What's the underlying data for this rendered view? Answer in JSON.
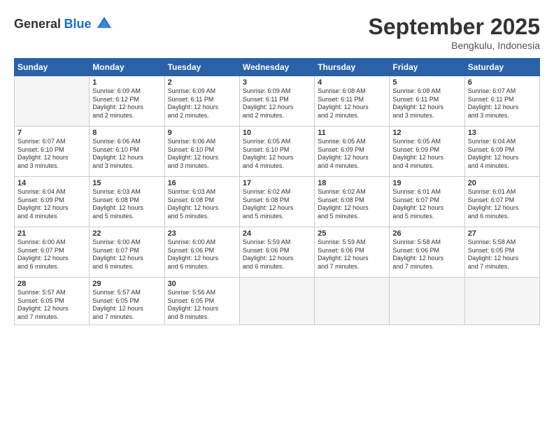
{
  "logo": {
    "general": "General",
    "blue": "Blue"
  },
  "header": {
    "title": "September 2025",
    "subtitle": "Bengkulu, Indonesia"
  },
  "weekdays": [
    "Sunday",
    "Monday",
    "Tuesday",
    "Wednesday",
    "Thursday",
    "Friday",
    "Saturday"
  ],
  "weeks": [
    [
      {
        "day": "",
        "info": ""
      },
      {
        "day": "1",
        "info": "Sunrise: 6:09 AM\nSunset: 6:12 PM\nDaylight: 12 hours\nand 2 minutes."
      },
      {
        "day": "2",
        "info": "Sunrise: 6:09 AM\nSunset: 6:11 PM\nDaylight: 12 hours\nand 2 minutes."
      },
      {
        "day": "3",
        "info": "Sunrise: 6:09 AM\nSunset: 6:11 PM\nDaylight: 12 hours\nand 2 minutes."
      },
      {
        "day": "4",
        "info": "Sunrise: 6:08 AM\nSunset: 6:11 PM\nDaylight: 12 hours\nand 2 minutes."
      },
      {
        "day": "5",
        "info": "Sunrise: 6:08 AM\nSunset: 6:11 PM\nDaylight: 12 hours\nand 3 minutes."
      },
      {
        "day": "6",
        "info": "Sunrise: 6:07 AM\nSunset: 6:11 PM\nDaylight: 12 hours\nand 3 minutes."
      }
    ],
    [
      {
        "day": "7",
        "info": "Sunrise: 6:07 AM\nSunset: 6:10 PM\nDaylight: 12 hours\nand 3 minutes."
      },
      {
        "day": "8",
        "info": "Sunrise: 6:06 AM\nSunset: 6:10 PM\nDaylight: 12 hours\nand 3 minutes."
      },
      {
        "day": "9",
        "info": "Sunrise: 6:06 AM\nSunset: 6:10 PM\nDaylight: 12 hours\nand 3 minutes."
      },
      {
        "day": "10",
        "info": "Sunrise: 6:05 AM\nSunset: 6:10 PM\nDaylight: 12 hours\nand 4 minutes."
      },
      {
        "day": "11",
        "info": "Sunrise: 6:05 AM\nSunset: 6:09 PM\nDaylight: 12 hours\nand 4 minutes."
      },
      {
        "day": "12",
        "info": "Sunrise: 6:05 AM\nSunset: 6:09 PM\nDaylight: 12 hours\nand 4 minutes."
      },
      {
        "day": "13",
        "info": "Sunrise: 6:04 AM\nSunset: 6:09 PM\nDaylight: 12 hours\nand 4 minutes."
      }
    ],
    [
      {
        "day": "14",
        "info": "Sunrise: 6:04 AM\nSunset: 6:09 PM\nDaylight: 12 hours\nand 4 minutes."
      },
      {
        "day": "15",
        "info": "Sunrise: 6:03 AM\nSunset: 6:08 PM\nDaylight: 12 hours\nand 5 minutes."
      },
      {
        "day": "16",
        "info": "Sunrise: 6:03 AM\nSunset: 6:08 PM\nDaylight: 12 hours\nand 5 minutes."
      },
      {
        "day": "17",
        "info": "Sunrise: 6:02 AM\nSunset: 6:08 PM\nDaylight: 12 hours\nand 5 minutes."
      },
      {
        "day": "18",
        "info": "Sunrise: 6:02 AM\nSunset: 6:08 PM\nDaylight: 12 hours\nand 5 minutes."
      },
      {
        "day": "19",
        "info": "Sunrise: 6:01 AM\nSunset: 6:07 PM\nDaylight: 12 hours\nand 5 minutes."
      },
      {
        "day": "20",
        "info": "Sunrise: 6:01 AM\nSunset: 6:07 PM\nDaylight: 12 hours\nand 6 minutes."
      }
    ],
    [
      {
        "day": "21",
        "info": "Sunrise: 6:00 AM\nSunset: 6:07 PM\nDaylight: 12 hours\nand 6 minutes."
      },
      {
        "day": "22",
        "info": "Sunrise: 6:00 AM\nSunset: 6:07 PM\nDaylight: 12 hours\nand 6 minutes."
      },
      {
        "day": "23",
        "info": "Sunrise: 6:00 AM\nSunset: 6:06 PM\nDaylight: 12 hours\nand 6 minutes."
      },
      {
        "day": "24",
        "info": "Sunrise: 5:59 AM\nSunset: 6:06 PM\nDaylight: 12 hours\nand 6 minutes."
      },
      {
        "day": "25",
        "info": "Sunrise: 5:59 AM\nSunset: 6:06 PM\nDaylight: 12 hours\nand 7 minutes."
      },
      {
        "day": "26",
        "info": "Sunrise: 5:58 AM\nSunset: 6:06 PM\nDaylight: 12 hours\nand 7 minutes."
      },
      {
        "day": "27",
        "info": "Sunrise: 5:58 AM\nSunset: 6:05 PM\nDaylight: 12 hours\nand 7 minutes."
      }
    ],
    [
      {
        "day": "28",
        "info": "Sunrise: 5:57 AM\nSunset: 6:05 PM\nDaylight: 12 hours\nand 7 minutes."
      },
      {
        "day": "29",
        "info": "Sunrise: 5:57 AM\nSunset: 6:05 PM\nDaylight: 12 hours\nand 7 minutes."
      },
      {
        "day": "30",
        "info": "Sunrise: 5:56 AM\nSunset: 6:05 PM\nDaylight: 12 hours\nand 8 minutes."
      },
      {
        "day": "",
        "info": ""
      },
      {
        "day": "",
        "info": ""
      },
      {
        "day": "",
        "info": ""
      },
      {
        "day": "",
        "info": ""
      }
    ]
  ]
}
